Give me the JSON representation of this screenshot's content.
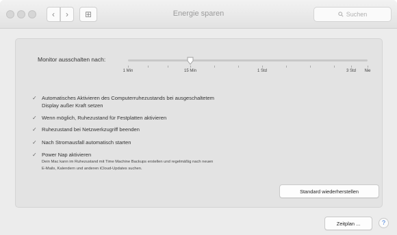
{
  "window": {
    "title": "Energie sparen"
  },
  "toolbar": {
    "back_glyph": "‹",
    "forward_glyph": "›",
    "grid_glyph": "⊞",
    "search_icon": "search-icon",
    "search_placeholder": "Suchen"
  },
  "monitor": {
    "label": "Monitor ausschalten nach:",
    "ticks": [
      "1 Min",
      "15 Min",
      "1 Std",
      "3 Std",
      "Nie"
    ],
    "selected": "15 Min"
  },
  "options": [
    {
      "label": "Automatisches Aktivieren des Computerruhezustands bei ausgeschaltetem",
      "label2": "Display außer Kraft setzen",
      "checked": true
    },
    {
      "label": "Wenn möglich, Ruhezustand für Festplatten aktivieren",
      "checked": true
    },
    {
      "label": "Ruhezustand bei Netzwerkzugriff beenden",
      "checked": true
    },
    {
      "label": "Nach Stromausfall automatisch starten",
      "checked": true
    },
    {
      "label": "Power Nap aktivieren",
      "checked": true,
      "desc1": "Dein Mac kann im Ruhezustand mit Time Machine Backups erstellen und regelmäßig nach neuen",
      "desc2": "E-Mails, Kalendern und anderen iCloud-Updates suchen."
    }
  ],
  "buttons": {
    "restore_defaults": "Standard wiederherstellen",
    "schedule": "Zeitplan ...",
    "help": "?"
  },
  "check_glyph": "✓"
}
